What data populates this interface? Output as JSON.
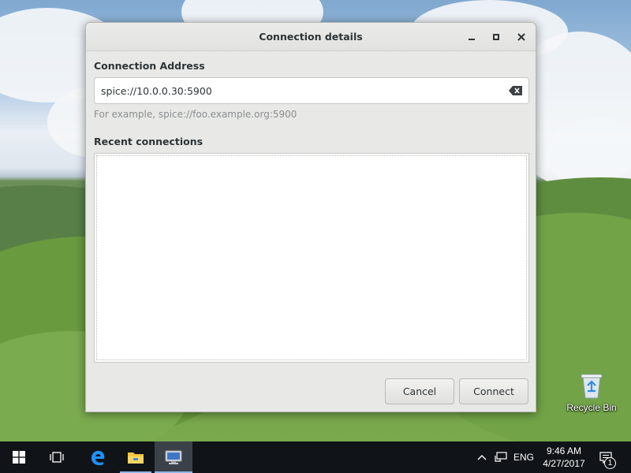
{
  "dialog": {
    "title": "Connection details",
    "address_label": "Connection Address",
    "address_value": "spice://10.0.0.30:5900",
    "address_hint": "For example, spice://foo.example.org:5900",
    "recent_label": "Recent connections",
    "recent_items": [],
    "buttons": {
      "cancel": "Cancel",
      "connect": "Connect"
    },
    "window_controls": [
      "minimize-icon",
      "maximize-icon",
      "close-icon"
    ]
  },
  "desktop": {
    "icons": [
      {
        "label": "Recycle Bin",
        "icon": "recycle-bin-icon"
      }
    ]
  },
  "taskbar": {
    "items": [
      {
        "icon": "windows-start-icon"
      },
      {
        "icon": "task-view-icon"
      },
      {
        "icon": "edge-browser-icon"
      },
      {
        "icon": "file-explorer-icon"
      },
      {
        "icon": "remote-viewer-icon",
        "state": "active"
      }
    ],
    "tray": {
      "language": "ENG",
      "time": "9:46 AM",
      "date": "4/27/2017",
      "notification_count": "1"
    }
  },
  "colors": {
    "dialog_bg": "#e8e8e7",
    "taskbar_bg": "#101418",
    "accent": "#8fb6e8"
  }
}
